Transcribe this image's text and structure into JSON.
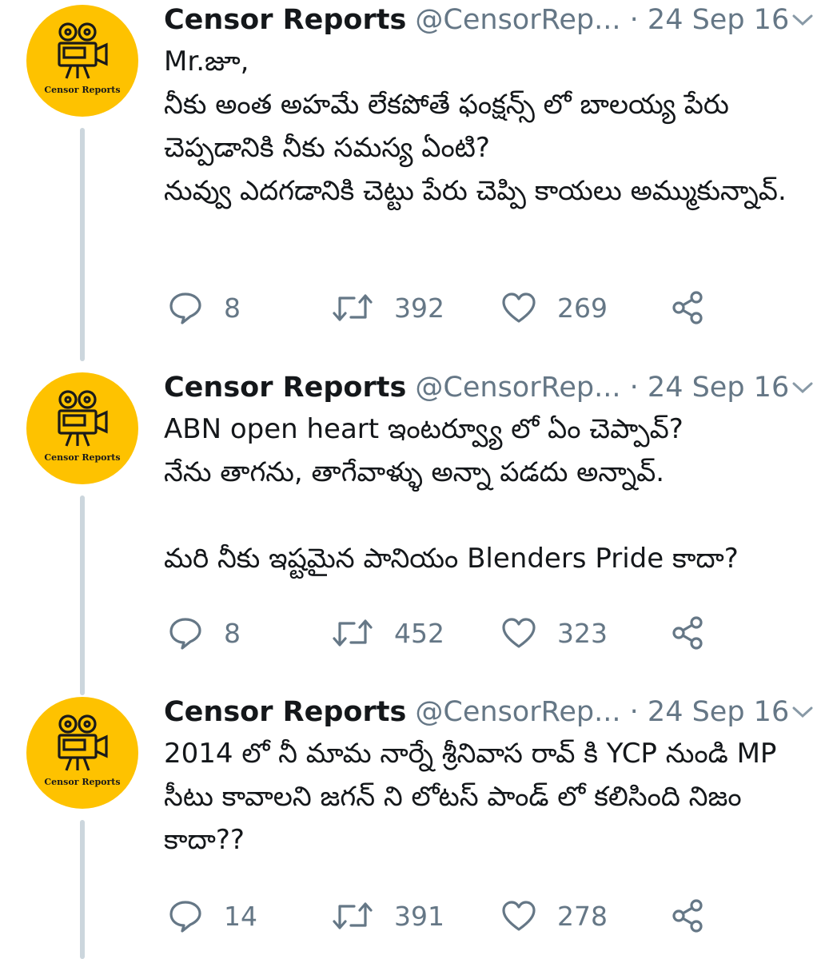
{
  "tweets": [
    {
      "name": "Censor Reports",
      "handle": "@CensorRep...",
      "separator": "·",
      "date": "24 Sep 16",
      "avatar_label": "Censor Reports",
      "text": "Mr.జూ,\nనీకు అంత అహమే లేకపోతే ఫంక్షన్స్ లో బాలయ్య పేరు చెప్పడానికి నీకు సమస్య ఏంటి?\nనువ్వు ఎదగడానికి చెట్టు పేరు చెప్పి కాయలు అమ్ముకున్నావ్.",
      "replies": "8",
      "retweets": "392",
      "likes": "269"
    },
    {
      "name": "Censor Reports",
      "handle": "@CensorRep...",
      "separator": "·",
      "date": "24 Sep 16",
      "avatar_label": "Censor Reports",
      "text": "ABN open heart ఇంటర్వ్యూ లో ఏం చెప్పావ్?\nనేను తాగను, తాగేవాళ్ళు అన్నా పడదు అన్నావ్.\n\nమరి నీకు ఇష్టమైన పానియం Blenders Pride కాదా?",
      "replies": "8",
      "retweets": "452",
      "likes": "323"
    },
    {
      "name": "Censor Reports",
      "handle": "@CensorRep...",
      "separator": "·",
      "date": "24 Sep 16",
      "avatar_label": "Censor Reports",
      "text": "2014 లో నీ మామ నార్నే శ్రీనివాస రావ్ కి YCP నుండి MP సీటు కావాలని జగన్ ని లోటస్ పాండ్ లో కలిసింది నిజం కాదా??",
      "replies": "14",
      "retweets": "391",
      "likes": "278"
    }
  ],
  "icons": {
    "reply": "reply-icon",
    "retweet": "retweet-icon",
    "like": "heart-icon",
    "share": "share-icon",
    "more": "chevron-down-icon",
    "avatar": "film-camera-icon"
  },
  "colors": {
    "avatar_bg": "#fec200",
    "muted": "#657786",
    "thread_line": "#ccd6dd",
    "text": "#14171a"
  }
}
